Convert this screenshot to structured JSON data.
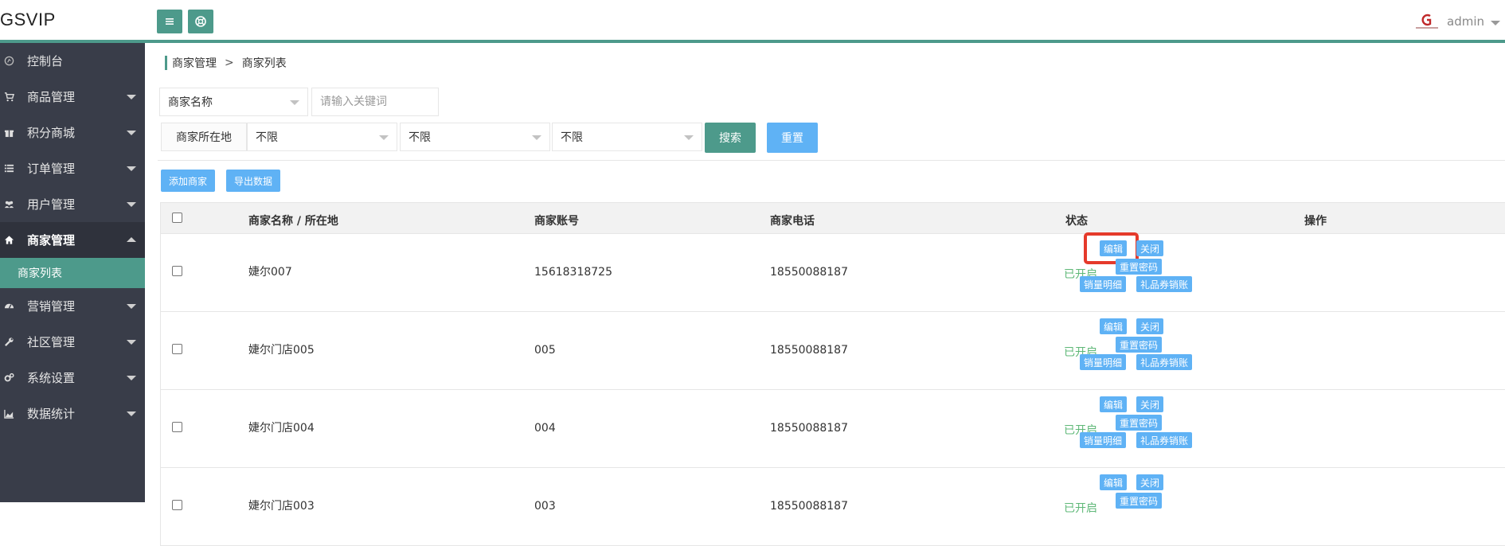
{
  "app": {
    "logo": "GSVIP"
  },
  "header": {
    "username": "admin",
    "menu_icon": "hamburger-icon",
    "refresh_icon": "lifebuoy-icon"
  },
  "sidebar": {
    "items": [
      {
        "label": "控制台",
        "icon": "console-icon"
      },
      {
        "label": "商品管理",
        "icon": "cart-icon"
      },
      {
        "label": "积分商城",
        "icon": "gift-icon"
      },
      {
        "label": "订单管理",
        "icon": "list-icon"
      },
      {
        "label": "用户管理",
        "icon": "users-icon"
      },
      {
        "label": "商家管理",
        "icon": "home-icon"
      },
      {
        "label": "营销管理",
        "icon": "dashboard-icon"
      },
      {
        "label": "社区管理",
        "icon": "wrench-icon"
      },
      {
        "label": "系统设置",
        "icon": "gears-icon"
      },
      {
        "label": "数据统计",
        "icon": "area-chart-icon"
      }
    ],
    "active_sub": "商家列表"
  },
  "breadcrumb": {
    "parent": "商家管理",
    "separator": ">",
    "current": "商家列表"
  },
  "filters": {
    "field_select": "商家名称",
    "keyword_placeholder": "请输入关键词",
    "location_label": "商家所在地",
    "province": "不限",
    "city": "不限",
    "district": "不限",
    "search_label": "搜索",
    "reset_label": "重置"
  },
  "toolbar": {
    "add_label": "添加商家",
    "export_label": "导出数据"
  },
  "table": {
    "columns": [
      "商家名称 / 所在地",
      "商家账号",
      "商家电话",
      "状态",
      "操作"
    ],
    "rows": [
      {
        "name": "婕尔007",
        "account": "15618318725",
        "phone": "18550088187",
        "status": "已开启"
      },
      {
        "name": "婕尔门店005",
        "account": "005",
        "phone": "18550088187",
        "status": "已开启"
      },
      {
        "name": "婕尔门店004",
        "account": "004",
        "phone": "18550088187",
        "status": "已开启"
      },
      {
        "name": "婕尔门店003",
        "account": "003",
        "phone": "18550088187",
        "status": "已开启"
      }
    ],
    "actions": {
      "edit": "编辑",
      "close": "关闭",
      "reset_pwd": "重置密码",
      "sales_detail": "销量明细",
      "voucher": "礼品券销账"
    }
  },
  "colors": {
    "brand": "#4d9a8b",
    "sidebar": "#393d49",
    "button_blue": "#5fb2f5",
    "status_green": "#5fb878",
    "highlight": "#e53a2b"
  }
}
